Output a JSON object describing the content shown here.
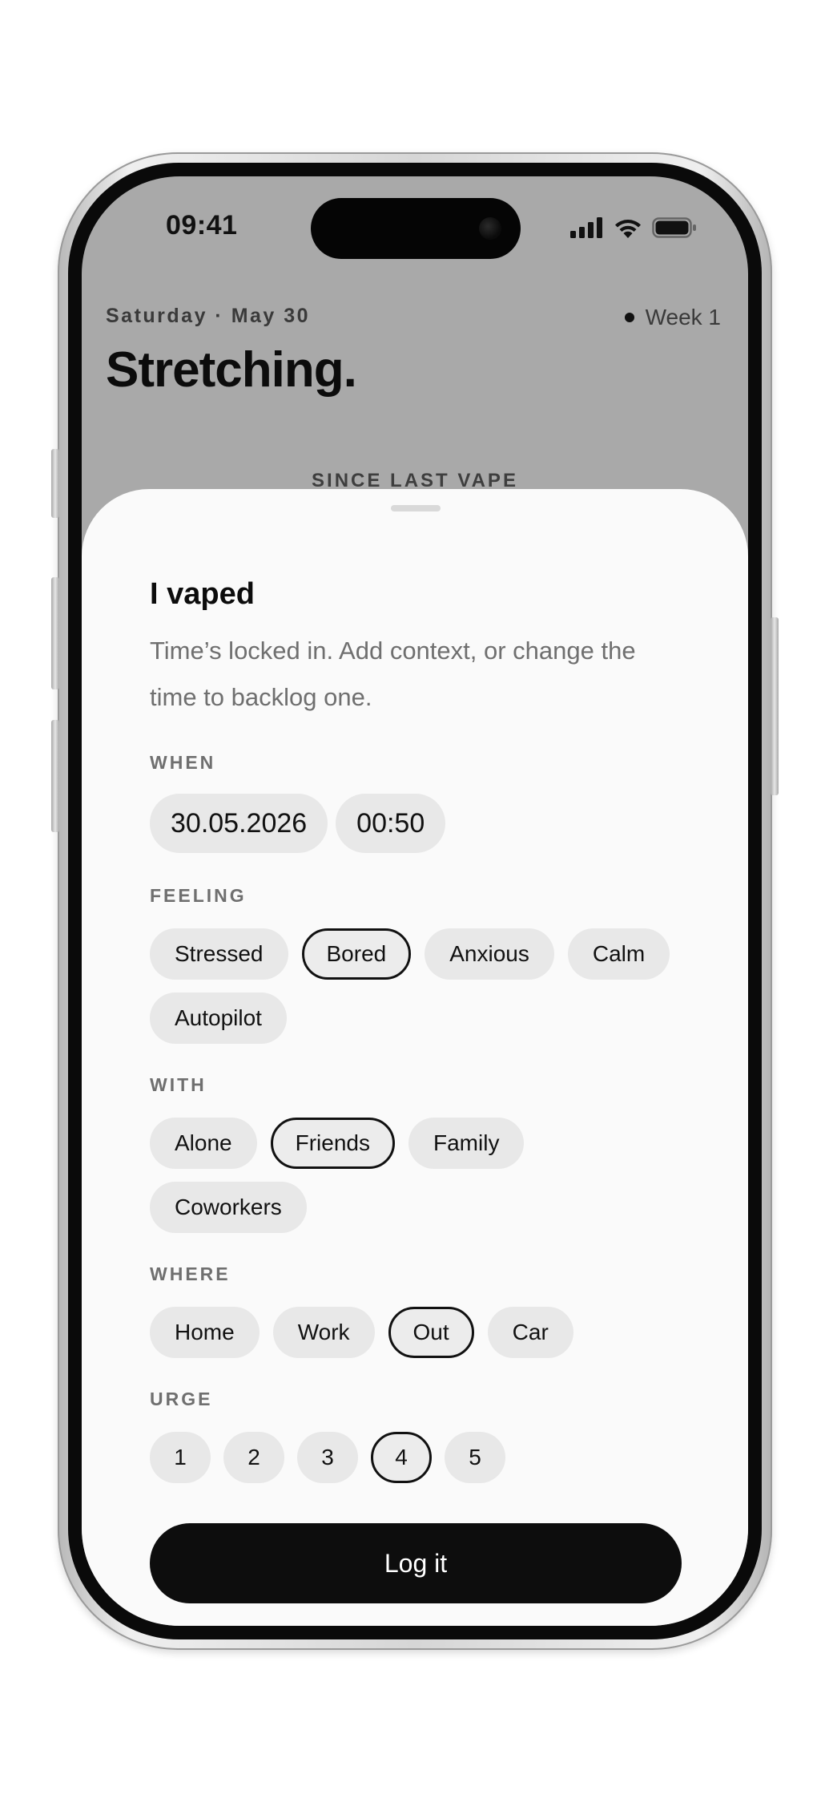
{
  "status_bar": {
    "time": "09:41",
    "icons": [
      "cellular-signal-icon",
      "wifi-icon",
      "battery-icon"
    ]
  },
  "background": {
    "date_line": "Saturday · May 30",
    "week_label": "Week 1",
    "mood_title": "Stretching.",
    "since_label": "SINCE LAST VAPE"
  },
  "sheet": {
    "title": "I vaped",
    "subtitle": "Time’s locked in. Add context, or change the time to backlog one.",
    "when": {
      "label": "WHEN",
      "date": "30.05.2026",
      "time": "00:50"
    },
    "feeling": {
      "label": "FEELING",
      "options": [
        "Stressed",
        "Bored",
        "Anxious",
        "Calm",
        "Autopilot"
      ],
      "selected": "Bored"
    },
    "with": {
      "label": "WITH",
      "options": [
        "Alone",
        "Friends",
        "Family",
        "Coworkers"
      ],
      "selected": "Friends"
    },
    "where": {
      "label": "WHERE",
      "options": [
        "Home",
        "Work",
        "Out",
        "Car"
      ],
      "selected": "Out"
    },
    "urge": {
      "label": "URGE",
      "options": [
        "1",
        "2",
        "3",
        "4",
        "5"
      ],
      "selected": "4"
    },
    "submit_label": "Log it"
  },
  "colors": {
    "accent": "#0d0d0d",
    "chip_background": "#e8e8e8",
    "sheet_background": "#fafafa",
    "screen_background": "#a9a9a9"
  }
}
